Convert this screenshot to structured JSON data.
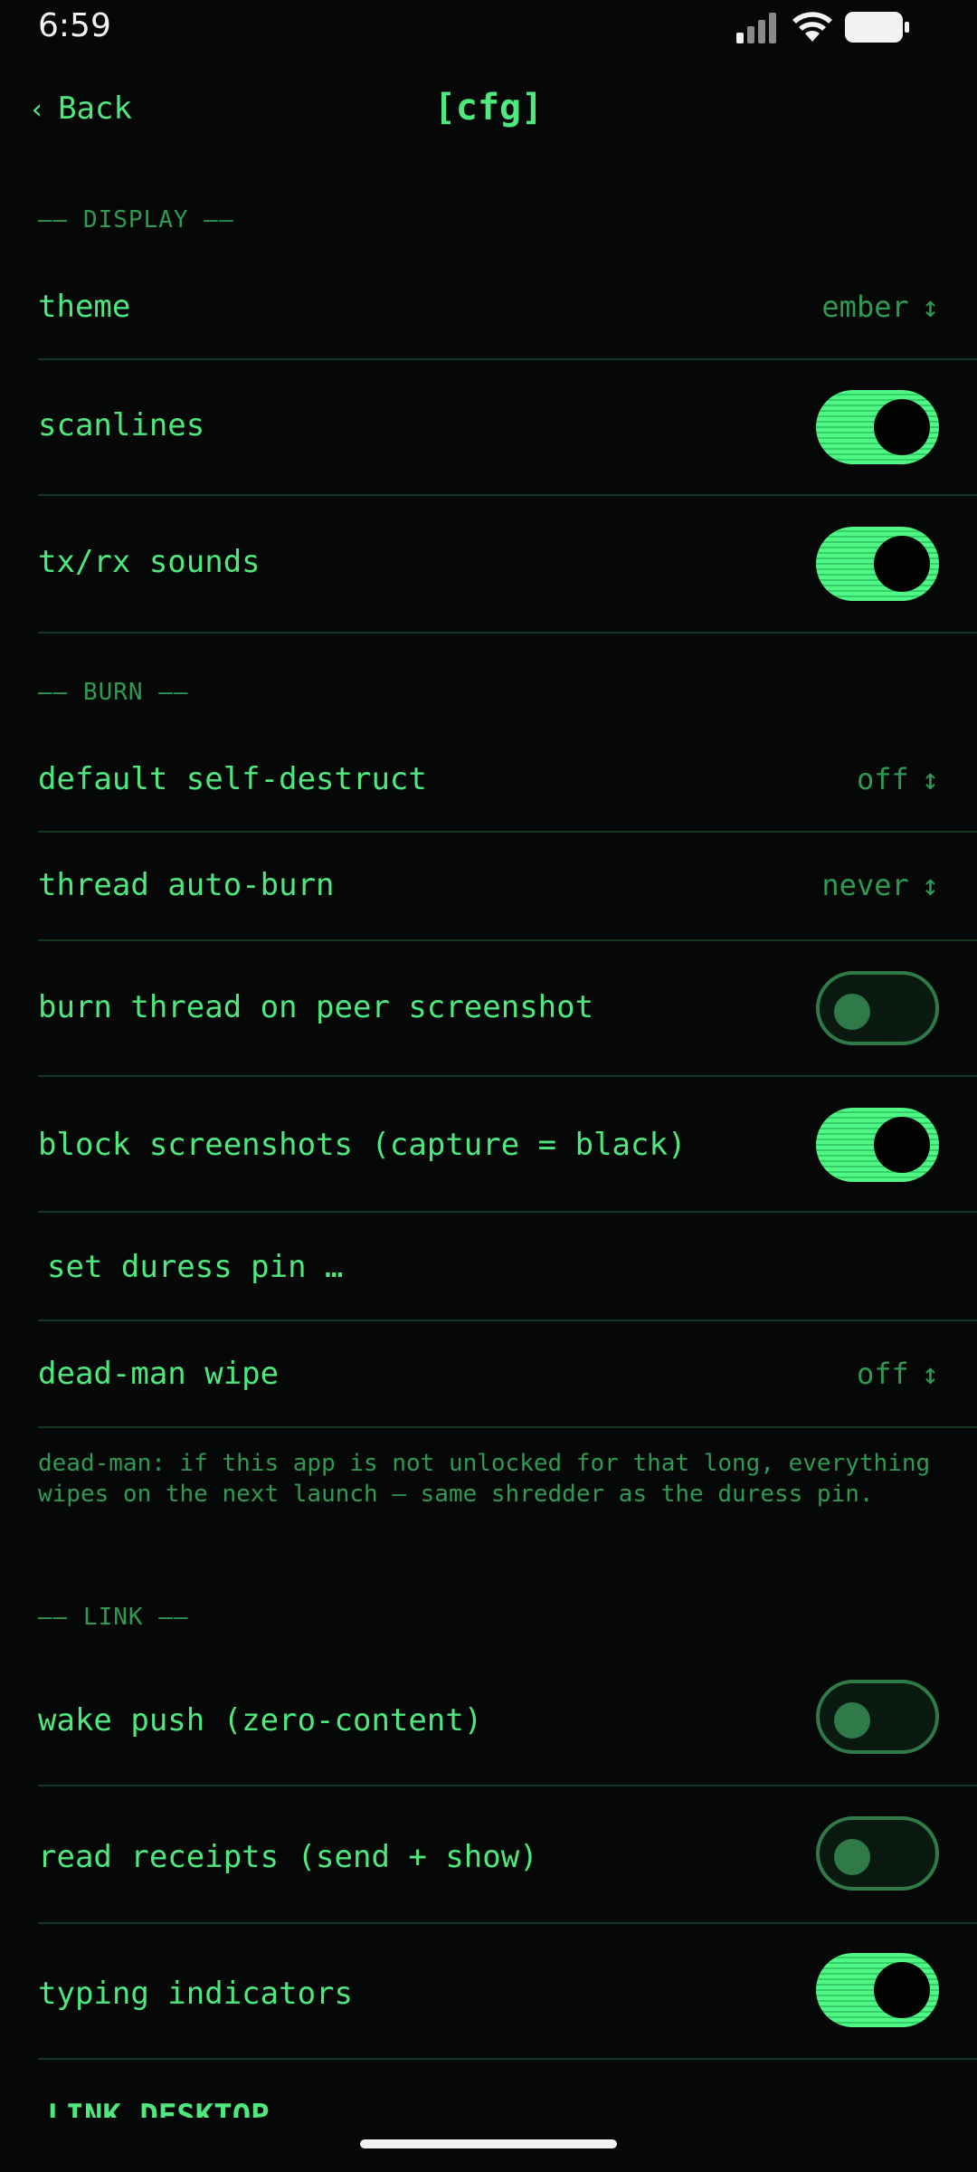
{
  "status_bar": {
    "time": "6:59"
  },
  "nav": {
    "back_chevron": "‹",
    "back_label": "Back",
    "title": "[cfg]"
  },
  "sections": {
    "display": "—— DISPLAY ——",
    "burn": "—— BURN ——",
    "link": "—— LINK ——"
  },
  "rows": {
    "theme": {
      "label": "theme",
      "value": "ember",
      "updown": "↕"
    },
    "scanlines": {
      "label": "scanlines",
      "on": true
    },
    "txrx": {
      "label": "tx/rx sounds",
      "on": true
    },
    "self_destruct": {
      "label": "default self-destruct",
      "value": "off",
      "updown": "↕"
    },
    "auto_burn": {
      "label": "thread auto-burn",
      "value": "never",
      "updown": "↕"
    },
    "burn_peer": {
      "label": "burn thread on peer screenshot",
      "on": false
    },
    "block_ss": {
      "label": "block screenshots (capture = black)",
      "on": true
    },
    "duress": {
      "label": "set duress pin …"
    },
    "deadman": {
      "label": "dead-man wipe",
      "value": "off",
      "updown": "↕"
    },
    "wake_push": {
      "label": "wake push (zero-content)",
      "on": false
    },
    "read_receipts": {
      "label": "read receipts (send + show)",
      "on": false
    },
    "typing": {
      "label": "typing indicators",
      "on": true
    }
  },
  "note": "dead-man: if this app is not unlocked for that long, everything wipes on the next launch — same shredder as the duress pin.",
  "next_section_cutoff": "LINK DESKTOP",
  "colors": {
    "accent": "#4ee87e",
    "dim": "#2f9a52",
    "background": "#050807",
    "divider": "#173420"
  }
}
